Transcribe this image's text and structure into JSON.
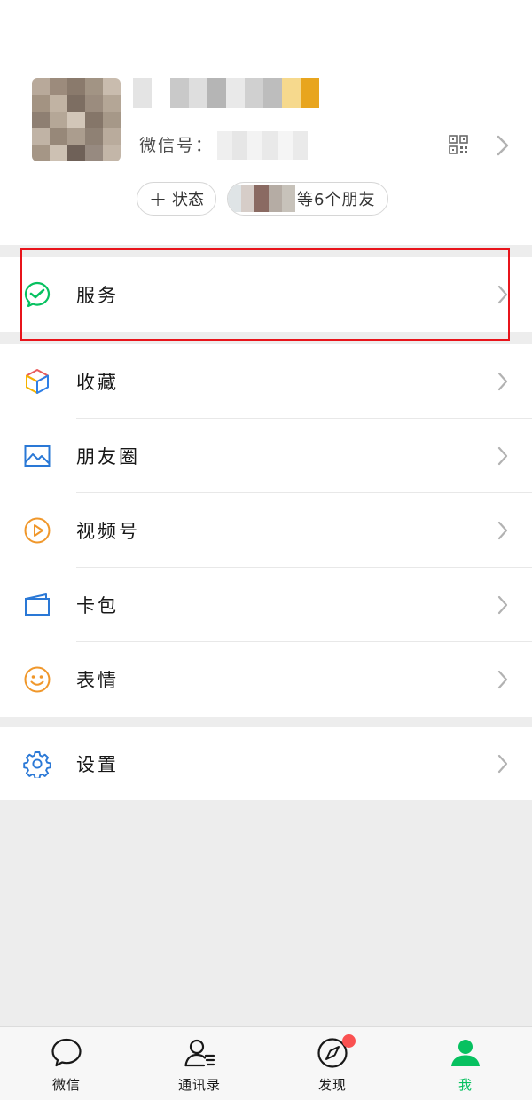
{
  "profile": {
    "wxid_label": "微信号：",
    "status_label": "状态",
    "friends_text": "等6个朋友",
    "avatar_pixels": [
      "#b8a99a",
      "#9c8b7c",
      "#8a7a6c",
      "#a29484",
      "#c9bcae",
      "#a39382",
      "#c1b3a3",
      "#7d6e62",
      "#9b8c7e",
      "#b4a696",
      "#8e7f72",
      "#b5a797",
      "#d2c6b8",
      "#857669",
      "#a69888",
      "#c0b3a5",
      "#978879",
      "#ab9d8e",
      "#8f8174",
      "#b9ab9c",
      "#a59686",
      "#cdc1b3",
      "#6f6158",
      "#978a80",
      "#c3b6a8"
    ],
    "nickname_pixels": [
      "#e4e4e4",
      "#ffffff",
      "#c9c9c9",
      "#dedede",
      "#b5b5b5",
      "#e9e9e9",
      "#d0d0d0",
      "#bdbdbd",
      "#f6d98d",
      "#e8a51e"
    ],
    "wxid_pixels": [
      "#efefef",
      "#e6e6e6",
      "#f3f3f3",
      "#e9e9e9",
      "#f5f5f5",
      "#eaeaea"
    ],
    "friend_pixels": [
      "#dfe4e6",
      "#d6cdc8",
      "#8a6a62",
      "#b5aca4",
      "#c7c2ba"
    ]
  },
  "sections": [
    {
      "items": [
        {
          "label": "服务",
          "icon": "service-icon"
        }
      ]
    },
    {
      "items": [
        {
          "label": "收藏",
          "icon": "favorites-icon"
        },
        {
          "label": "朋友圈",
          "icon": "moments-icon"
        },
        {
          "label": "视频号",
          "icon": "channels-icon"
        },
        {
          "label": "卡包",
          "icon": "card-wallet-icon"
        },
        {
          "label": "表情",
          "icon": "stickers-icon"
        }
      ]
    },
    {
      "items": [
        {
          "label": "设置",
          "icon": "settings-icon"
        }
      ]
    }
  ],
  "tabs": [
    {
      "label": "微信",
      "icon": "chat-icon",
      "active": false
    },
    {
      "label": "通讯录",
      "icon": "contacts-icon",
      "active": false
    },
    {
      "label": "发现",
      "icon": "discover-icon",
      "active": false,
      "badge": true
    },
    {
      "label": "我",
      "icon": "me-icon",
      "active": true
    }
  ],
  "colors": {
    "accent": "#07c160",
    "highlight": "#e8141b",
    "badge": "#fa5151",
    "background": "#ededed"
  }
}
